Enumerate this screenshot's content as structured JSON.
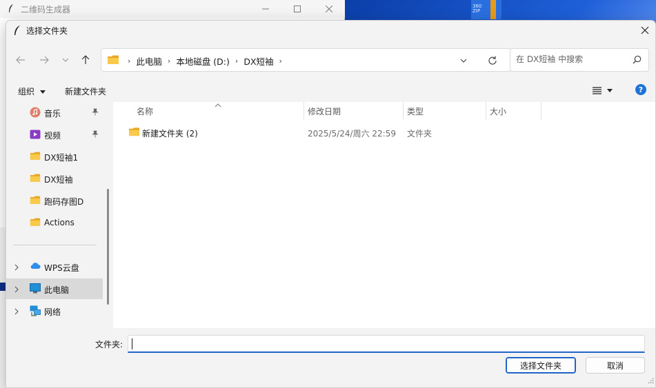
{
  "parent_window": {
    "title": "二维码生成器"
  },
  "dialog": {
    "title": "选择文件夹"
  },
  "address": {
    "crumbs": [
      "此电脑",
      "本地磁盘 (D:)",
      "DX短袖"
    ]
  },
  "search": {
    "placeholder": "在 DX短袖 中搜索"
  },
  "toolbar": {
    "organize_label": "组织",
    "new_folder_label": "新建文件夹"
  },
  "nav": {
    "items": [
      {
        "label": "音乐",
        "icon": "music-icon",
        "pinned": true
      },
      {
        "label": "视频",
        "icon": "video-icon",
        "pinned": true
      },
      {
        "label": "DX短袖1",
        "icon": "folder-icon"
      },
      {
        "label": "DX短袖",
        "icon": "folder-icon"
      },
      {
        "label": "跑码存图D",
        "icon": "folder-icon"
      },
      {
        "label": "Actions",
        "icon": "folder-icon"
      },
      {
        "label": "WPS云盘",
        "icon": "cloud-icon",
        "expandable": true
      },
      {
        "label": "此电脑",
        "icon": "computer-icon",
        "expandable": true,
        "selected": true
      },
      {
        "label": "网络",
        "icon": "network-icon",
        "expandable": true
      }
    ]
  },
  "file_list": {
    "columns": [
      "名称",
      "修改日期",
      "类型",
      "大小"
    ],
    "rows": [
      {
        "name": "新建文件夹 (2)",
        "date": "2025/5/24/周六 22:59",
        "type": "文件夹",
        "size": ""
      }
    ]
  },
  "bottom": {
    "folder_label": "文件夹:",
    "folder_value": "",
    "select_button": "选择文件夹",
    "cancel_button": "取消"
  },
  "colors": {
    "accent": "#1e63c8",
    "folder": "#f2c14e",
    "selected_nav": "#d9d9d9"
  }
}
